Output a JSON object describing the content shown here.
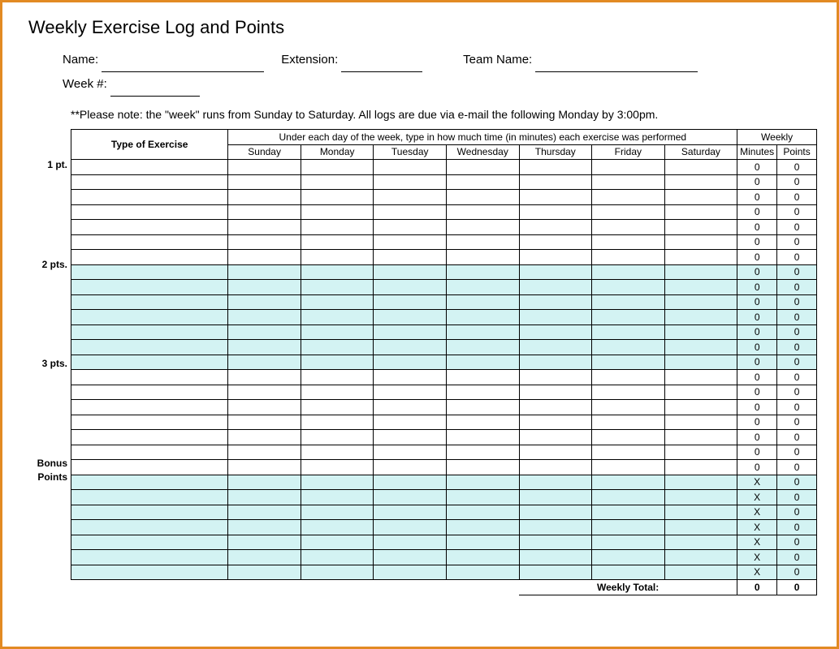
{
  "title": "Weekly Exercise Log and Points",
  "form": {
    "name_label": "Name:",
    "extension_label": "Extension:",
    "team_label": "Team Name:",
    "week_label": "Week #:"
  },
  "note": "**Please note: the \"week\" runs from Sunday to Saturday.  All logs are due via e-mail the following Monday by 3:00pm.",
  "headers": {
    "type": "Type of Exercise",
    "instruction": "Under each day of the week, type in how much time (in minutes) each exercise was performed",
    "weekly": "Weekly",
    "days": [
      "Sunday",
      "Monday",
      "Tuesday",
      "Wednesday",
      "Thursday",
      "Friday",
      "Saturday"
    ],
    "minutes": "Minutes",
    "points": "Points"
  },
  "sections": [
    {
      "label": "1 pt.",
      "rows": [
        {
          "min": "0",
          "pts": "0"
        },
        {
          "min": "0",
          "pts": "0"
        },
        {
          "min": "0",
          "pts": "0"
        },
        {
          "min": "0",
          "pts": "0"
        },
        {
          "min": "0",
          "pts": "0"
        },
        {
          "min": "0",
          "pts": "0"
        },
        {
          "min": "0",
          "pts": "0"
        }
      ],
      "shaded": false
    },
    {
      "label": "2 pts.",
      "rows": [
        {
          "min": "0",
          "pts": "0"
        },
        {
          "min": "0",
          "pts": "0"
        },
        {
          "min": "0",
          "pts": "0"
        },
        {
          "min": "0",
          "pts": "0"
        },
        {
          "min": "0",
          "pts": "0"
        },
        {
          "min": "0",
          "pts": "0"
        },
        {
          "min": "0",
          "pts": "0"
        }
      ],
      "shaded": true
    },
    {
      "label": "3 pts.",
      "rows": [
        {
          "min": "0",
          "pts": "0"
        },
        {
          "min": "0",
          "pts": "0"
        },
        {
          "min": "0",
          "pts": "0"
        },
        {
          "min": "0",
          "pts": "0"
        },
        {
          "min": "0",
          "pts": "0"
        },
        {
          "min": "0",
          "pts": "0"
        },
        {
          "min": "0",
          "pts": "0"
        }
      ],
      "shaded": false
    },
    {
      "label": "Bonus Points",
      "rows": [
        {
          "min": "X",
          "pts": "0"
        },
        {
          "min": "X",
          "pts": "0"
        },
        {
          "min": "X",
          "pts": "0"
        },
        {
          "min": "X",
          "pts": "0"
        },
        {
          "min": "X",
          "pts": "0"
        },
        {
          "min": "X",
          "pts": "0"
        },
        {
          "min": "X",
          "pts": "0"
        }
      ],
      "shaded": true
    }
  ],
  "total": {
    "label": "Weekly Total:",
    "minutes": "0",
    "points": "0"
  }
}
